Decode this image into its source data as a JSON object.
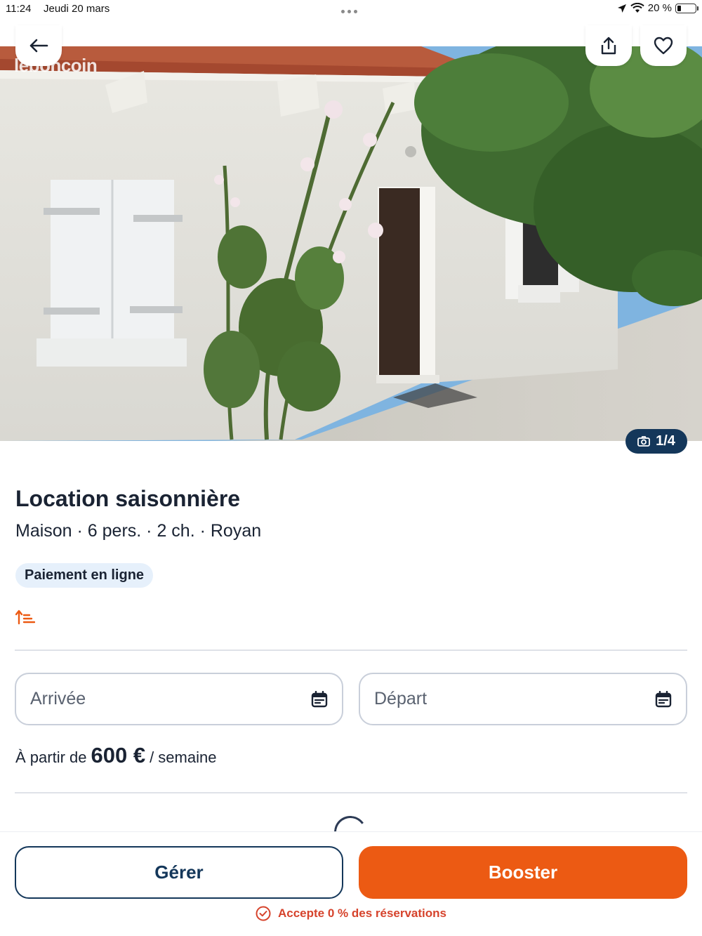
{
  "status_bar": {
    "time": "11:24",
    "date": "Jeudi 20 mars",
    "battery": "20 %"
  },
  "hero": {
    "watermark": "leboncoin",
    "photo_counter": "1/4"
  },
  "listing": {
    "title": "Location saisonnière",
    "subtitle": "Maison · 6 pers. · 2 ch. · Royan",
    "badge": "Paiement en ligne"
  },
  "dates": {
    "arrival_placeholder": "Arrivée",
    "departure_placeholder": "Départ"
  },
  "price": {
    "prefix": "À partir de",
    "amount": "600 €",
    "suffix": "/ semaine"
  },
  "actions": {
    "manage_label": "Gérer",
    "boost_label": "Booster",
    "accept_text": "Accepte 0 % des réservations"
  },
  "colors": {
    "accent": "#ec5a13",
    "navy": "#14375a",
    "badge_bg": "#e6f0fb",
    "alert": "#d6432c"
  },
  "icons": {
    "back": "arrow-left-icon",
    "share": "share-icon",
    "favorite": "heart-icon",
    "camera": "camera-icon",
    "rank": "sort-icon",
    "calendar": "calendar-icon",
    "check": "check-circle-icon"
  }
}
